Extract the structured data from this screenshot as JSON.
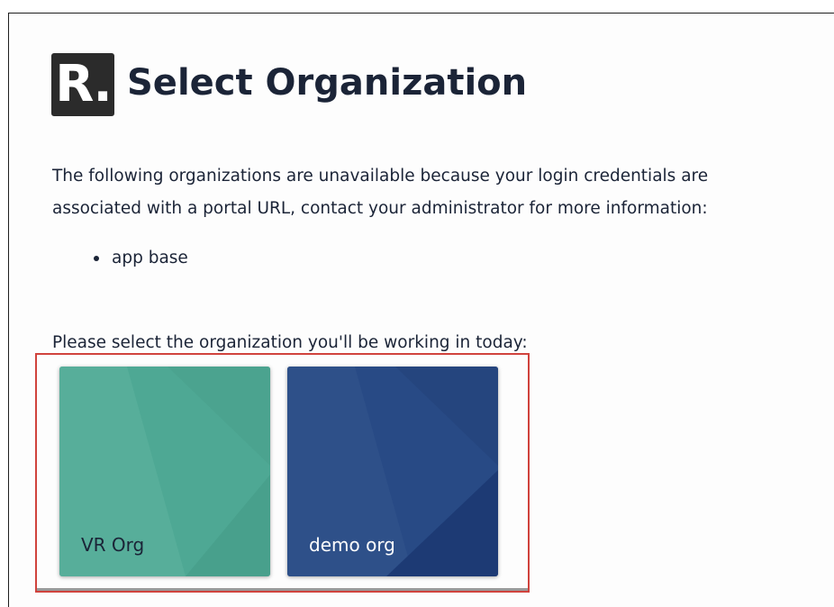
{
  "header": {
    "logo_text": "R.",
    "title": "Select Organization"
  },
  "notice": {
    "text": "The following organizations are unavailable because your login credentials are associated with a portal URL, contact your administrator for more information:",
    "unavailable_orgs": [
      {
        "name": "app base"
      }
    ]
  },
  "selection": {
    "prompt": "Please select the organization you'll be working in today:",
    "organizations": [
      {
        "name": "VR Org",
        "color": "#4ea894"
      },
      {
        "name": "demo org",
        "color": "#24427a"
      }
    ]
  },
  "colors": {
    "title_text": "#1b2437",
    "highlight_border": "#d0433d",
    "logo_bg": "#2b2b2b"
  }
}
